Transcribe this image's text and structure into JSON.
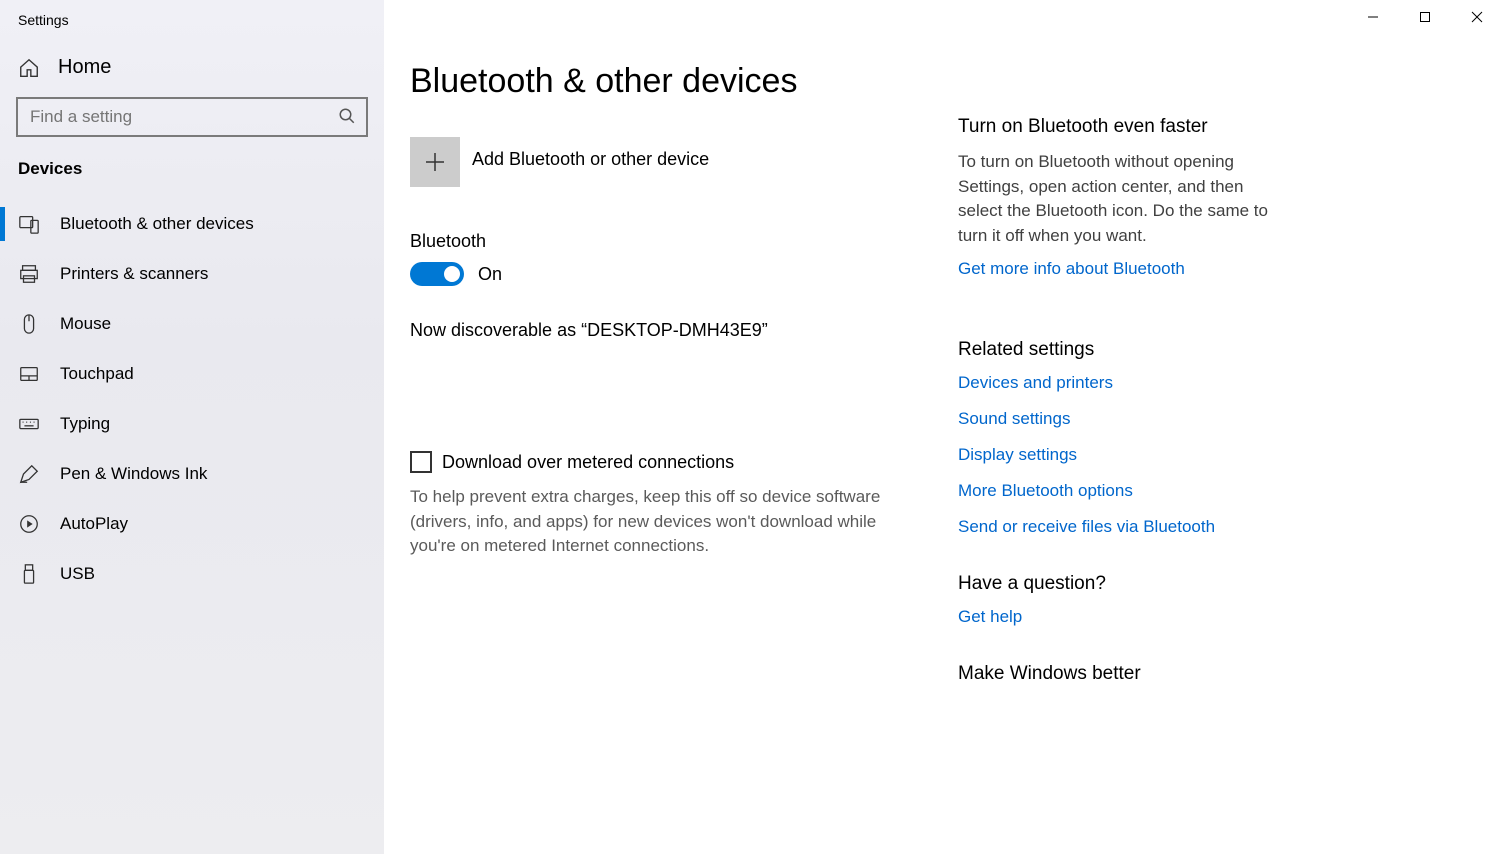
{
  "appTitle": "Settings",
  "home": "Home",
  "searchPlaceholder": "Find a setting",
  "categoryHeader": "Devices",
  "nav": [
    "Bluetooth & other devices",
    "Printers & scanners",
    "Mouse",
    "Touchpad",
    "Typing",
    "Pen & Windows Ink",
    "AutoPlay",
    "USB"
  ],
  "pageTitle": "Bluetooth & other devices",
  "addDevice": "Add Bluetooth or other device",
  "bluetoothLabel": "Bluetooth",
  "toggleState": "On",
  "discoverable": "Now discoverable as “DESKTOP-DMH43E9”",
  "meteredLabel": "Download over metered connections",
  "meteredHelp": "To help prevent extra charges, keep this off so device software (drivers, info, and apps) for new devices won't download while you're on metered Internet connections.",
  "tipHeading": "Turn on Bluetooth even faster",
  "tipBody": "To turn on Bluetooth without opening Settings, open action center, and then select the Bluetooth icon. Do the same to turn it off when you want.",
  "tipLink": "Get more info about Bluetooth",
  "relatedHeading": "Related settings",
  "relatedLinks": [
    "Devices and printers",
    "Sound settings",
    "Display settings",
    "More Bluetooth options",
    "Send or receive files via Bluetooth"
  ],
  "questionHeading": "Have a question?",
  "getHelp": "Get help",
  "improveHeading": "Make Windows better"
}
